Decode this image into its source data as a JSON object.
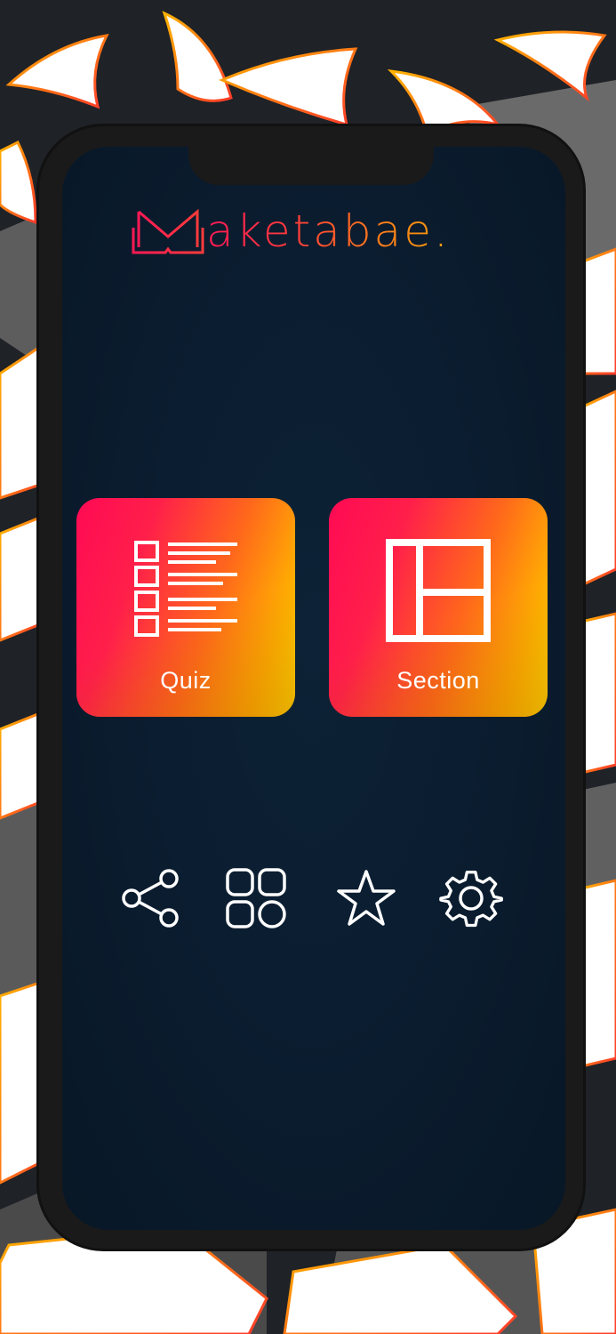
{
  "app": {
    "logo_text": "aketabae."
  },
  "tiles": [
    {
      "label": "Quiz",
      "icon": "quiz-list-icon"
    },
    {
      "label": "Section",
      "icon": "section-layout-icon"
    }
  ],
  "actions": [
    {
      "icon": "share-icon"
    },
    {
      "icon": "grid-icon"
    },
    {
      "icon": "star-icon"
    },
    {
      "icon": "gear-icon"
    }
  ],
  "colors": {
    "screen_bg": "#0b1d30",
    "tile_gradient_start": "#ff0a54",
    "tile_gradient_end": "#ffe600",
    "logo_gradient_start": "#ff1a55",
    "logo_gradient_end": "#f59e0b",
    "icon_stroke": "#ffffff"
  }
}
